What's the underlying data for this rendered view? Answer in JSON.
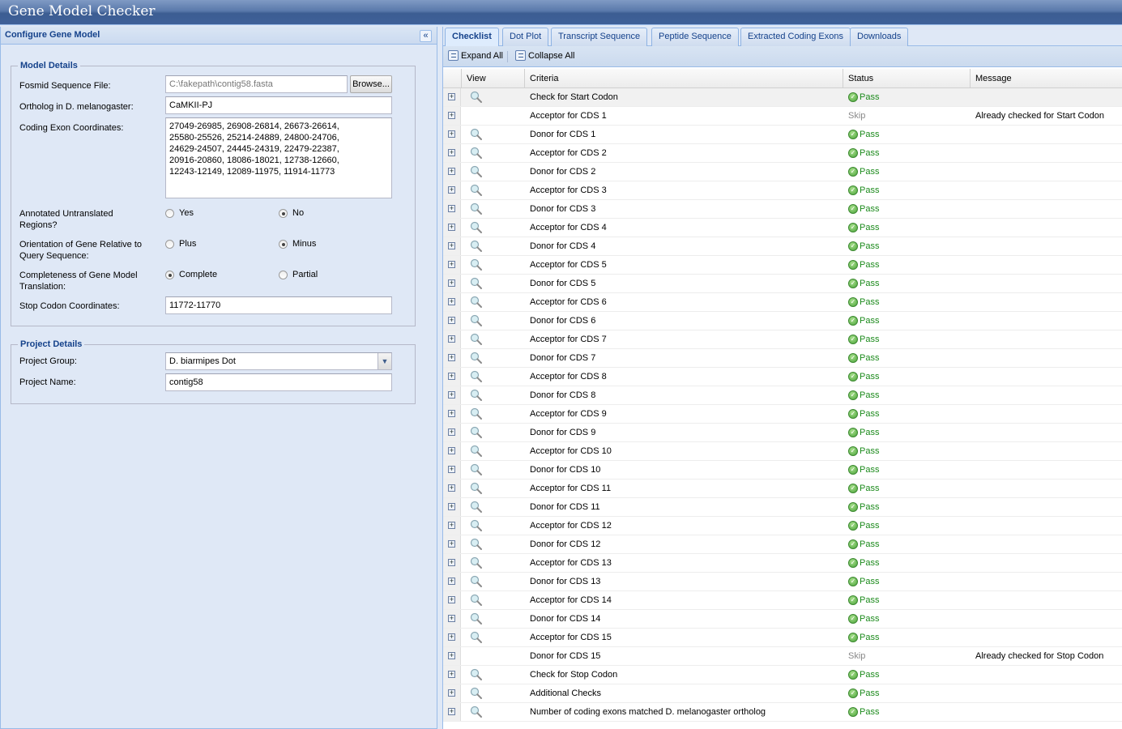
{
  "app": {
    "title": "Gene Model Checker"
  },
  "west": {
    "title": "Configure Gene Model",
    "collapse_icon": "double-chevron-left-icon",
    "model_details": {
      "legend": "Model Details",
      "fosmid_label": "Fosmid Sequence File:",
      "fosmid_value": "C:\\fakepath\\contig58.fasta",
      "browse_label": "Browse...",
      "ortholog_label": "Ortholog in D. melanogaster:",
      "ortholog_value": "CaMKII-PJ",
      "exons_label": "Coding Exon Coordinates:",
      "exons_value": "27049-26985, 26908-26814, 26673-26614,\n25580-25526, 25214-24889, 24800-24706,\n24629-24507, 24445-24319, 22479-22387,\n20916-20860, 18086-18021, 12738-12660,\n12243-12149, 12089-11975, 11914-11773",
      "utr_label": "Annotated Untranslated Regions?",
      "utr_options": [
        {
          "label": "Yes",
          "checked": false
        },
        {
          "label": "No",
          "checked": true
        }
      ],
      "orientation_label": "Orientation of Gene Relative to Query Sequence:",
      "orientation_options": [
        {
          "label": "Plus",
          "checked": false
        },
        {
          "label": "Minus",
          "checked": true
        }
      ],
      "completeness_label": "Completeness of Gene Model Translation:",
      "completeness_options": [
        {
          "label": "Complete",
          "checked": true
        },
        {
          "label": "Partial",
          "checked": false
        }
      ],
      "stop_label": "Stop Codon Coordinates:",
      "stop_value": "11772-11770"
    },
    "project_details": {
      "legend": "Project Details",
      "group_label": "Project Group:",
      "group_value": "D. biarmipes Dot",
      "name_label": "Project Name:",
      "name_value": "contig58"
    }
  },
  "tabs": [
    {
      "label": "Checklist",
      "active": true
    },
    {
      "label": "Dot Plot",
      "active": false
    },
    {
      "label": "Transcript Sequence",
      "active": false
    },
    {
      "label": "Peptide Sequence",
      "active": false
    },
    {
      "label": "Extracted Coding Exons",
      "active": false
    },
    {
      "label": "Downloads",
      "active": false
    }
  ],
  "toolbar": {
    "expand_all": "Expand All",
    "collapse_all": "Collapse All"
  },
  "grid": {
    "columns": [
      "View",
      "Criteria",
      "Status",
      "Message"
    ],
    "rows": [
      {
        "criteria": "Check for Start Codon",
        "status": "Pass",
        "message": "",
        "view": true
      },
      {
        "criteria": "Acceptor for CDS 1",
        "status": "Skip",
        "message": "Already checked for Start Codon",
        "view": false
      },
      {
        "criteria": "Donor for CDS 1",
        "status": "Pass",
        "message": "",
        "view": true
      },
      {
        "criteria": "Acceptor for CDS 2",
        "status": "Pass",
        "message": "",
        "view": true
      },
      {
        "criteria": "Donor for CDS 2",
        "status": "Pass",
        "message": "",
        "view": true
      },
      {
        "criteria": "Acceptor for CDS 3",
        "status": "Pass",
        "message": "",
        "view": true
      },
      {
        "criteria": "Donor for CDS 3",
        "status": "Pass",
        "message": "",
        "view": true
      },
      {
        "criteria": "Acceptor for CDS 4",
        "status": "Pass",
        "message": "",
        "view": true
      },
      {
        "criteria": "Donor for CDS 4",
        "status": "Pass",
        "message": "",
        "view": true
      },
      {
        "criteria": "Acceptor for CDS 5",
        "status": "Pass",
        "message": "",
        "view": true
      },
      {
        "criteria": "Donor for CDS 5",
        "status": "Pass",
        "message": "",
        "view": true
      },
      {
        "criteria": "Acceptor for CDS 6",
        "status": "Pass",
        "message": "",
        "view": true
      },
      {
        "criteria": "Donor for CDS 6",
        "status": "Pass",
        "message": "",
        "view": true
      },
      {
        "criteria": "Acceptor for CDS 7",
        "status": "Pass",
        "message": "",
        "view": true
      },
      {
        "criteria": "Donor for CDS 7",
        "status": "Pass",
        "message": "",
        "view": true
      },
      {
        "criteria": "Acceptor for CDS 8",
        "status": "Pass",
        "message": "",
        "view": true
      },
      {
        "criteria": "Donor for CDS 8",
        "status": "Pass",
        "message": "",
        "view": true
      },
      {
        "criteria": "Acceptor for CDS 9",
        "status": "Pass",
        "message": "",
        "view": true
      },
      {
        "criteria": "Donor for CDS 9",
        "status": "Pass",
        "message": "",
        "view": true
      },
      {
        "criteria": "Acceptor for CDS 10",
        "status": "Pass",
        "message": "",
        "view": true
      },
      {
        "criteria": "Donor for CDS 10",
        "status": "Pass",
        "message": "",
        "view": true
      },
      {
        "criteria": "Acceptor for CDS 11",
        "status": "Pass",
        "message": "",
        "view": true
      },
      {
        "criteria": "Donor for CDS 11",
        "status": "Pass",
        "message": "",
        "view": true
      },
      {
        "criteria": "Acceptor for CDS 12",
        "status": "Pass",
        "message": "",
        "view": true
      },
      {
        "criteria": "Donor for CDS 12",
        "status": "Pass",
        "message": "",
        "view": true
      },
      {
        "criteria": "Acceptor for CDS 13",
        "status": "Pass",
        "message": "",
        "view": true
      },
      {
        "criteria": "Donor for CDS 13",
        "status": "Pass",
        "message": "",
        "view": true
      },
      {
        "criteria": "Acceptor for CDS 14",
        "status": "Pass",
        "message": "",
        "view": true
      },
      {
        "criteria": "Donor for CDS 14",
        "status": "Pass",
        "message": "",
        "view": true
      },
      {
        "criteria": "Acceptor for CDS 15",
        "status": "Pass",
        "message": "",
        "view": true
      },
      {
        "criteria": "Donor for CDS 15",
        "status": "Skip",
        "message": "Already checked for Stop Codon",
        "view": false
      },
      {
        "criteria": "Check for Stop Codon",
        "status": "Pass",
        "message": "",
        "view": true
      },
      {
        "criteria": "Additional Checks",
        "status": "Pass",
        "message": "",
        "view": true
      },
      {
        "criteria": "Number of coding exons matched D. melanogaster ortholog",
        "status": "Pass",
        "message": "",
        "view": true
      }
    ]
  },
  "colors": {
    "pass": "#1b8a1b",
    "skip": "#888888",
    "accent": "#15428b"
  }
}
